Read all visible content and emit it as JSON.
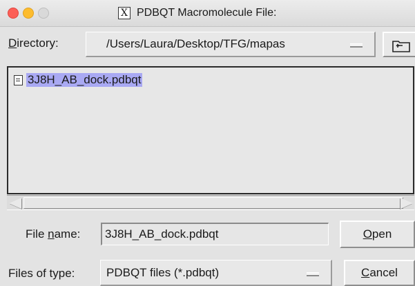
{
  "window": {
    "title": "PDBQT Macromolecule File:",
    "app_icon": "x11-icon",
    "app_icon_glyph": "X"
  },
  "directory": {
    "label": "Directory:",
    "mnemonic_char": "D",
    "label_rest": "irectory:",
    "path": "/Users/Laura/Desktop/TFG/mapas",
    "up_icon": "folder-up-icon"
  },
  "file_list": {
    "items": [
      {
        "name": "3J8H_AB_dock.pdbqt",
        "selected": true,
        "icon": "document-icon"
      }
    ]
  },
  "file_name": {
    "label_pre": "File ",
    "mnemonic_char": "n",
    "label_post": "ame:",
    "value": "3J8H_AB_dock.pdbqt"
  },
  "files_of_type": {
    "label": "Files of type:",
    "value": "PDBQT files (*.pdbqt)"
  },
  "buttons": {
    "open_mnemonic": "O",
    "open_rest": "pen",
    "cancel_mnemonic": "C",
    "cancel_rest": "ancel"
  },
  "colors": {
    "selection": "#a9a9f3",
    "background": "#e3e3e3"
  }
}
